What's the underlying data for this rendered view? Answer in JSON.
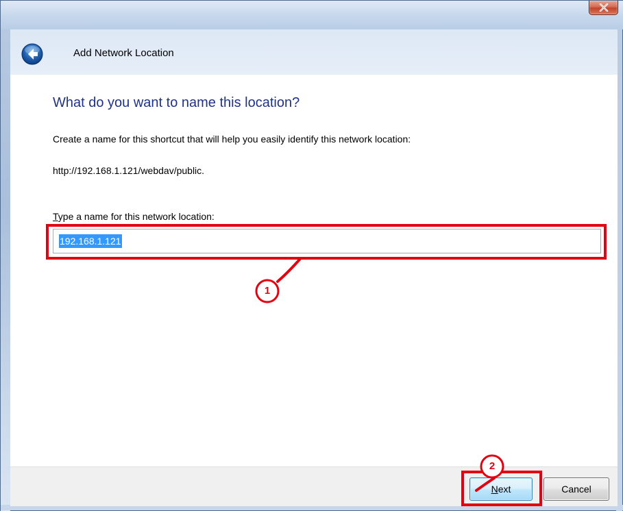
{
  "window": {
    "title": "Add Network Location",
    "close_icon": "close-icon",
    "back_icon": "back-arrow-icon"
  },
  "page": {
    "heading": "What do you want to name this location?",
    "description": "Create a name for this shortcut that will help you easily identify this network location:",
    "url": "http://192.168.1.121/webdav/public.",
    "field_label_accesskey": "T",
    "field_label_rest": "ype a name for this network location:",
    "name_value": "192.168.1.121"
  },
  "footer": {
    "next_accesskey": "N",
    "next_rest": "ext",
    "cancel_label": "Cancel"
  },
  "annotations": {
    "marker_1": "1",
    "marker_2": "2"
  },
  "colors": {
    "annotation_red": "#e3000f",
    "heading_blue": "#1e3287",
    "selection_blue": "#3399ff"
  }
}
